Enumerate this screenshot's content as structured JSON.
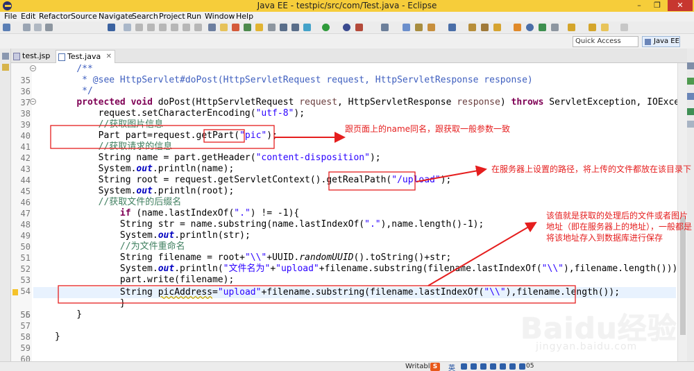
{
  "window": {
    "title": "Java EE - testpic/src/com/Test.java - Eclipse",
    "min": "–",
    "max": "❐",
    "close": "✕"
  },
  "menu": [
    "File",
    "Edit",
    "Refactor",
    "Source",
    "Navigate",
    "Search",
    "Project",
    "Run",
    "Window",
    "Help"
  ],
  "toolbar": {
    "quick_access_placeholder": "Quick Access",
    "perspective": "Java EE"
  },
  "tabs": [
    {
      "label": "test.jsp",
      "icon": "jsp-file-icon",
      "active": false
    },
    {
      "label": "Test.java",
      "icon": "java-file-icon",
      "active": true,
      "close": "✕"
    }
  ],
  "code_lines": [
    {
      "num": "35",
      "text": "    /**"
    },
    {
      "num": "36",
      "text": "     * @see HttpServlet#doPost(HttpServletRequest request, HttpServletResponse response)"
    },
    {
      "num": "37",
      "text": "     */"
    },
    {
      "num": "38",
      "text": "    protected void doPost(HttpServletRequest request, HttpServletResponse response) throws ServletException, IOException {"
    },
    {
      "num": "39",
      "text": "        request.setCharacterEncoding(\"utf-8\");"
    },
    {
      "num": "40",
      "text": "        //获取图片信息"
    },
    {
      "num": "41",
      "text": "        Part part=request.getPart(\"pic\");"
    },
    {
      "num": "42",
      "text": "        //获取请求的信息"
    },
    {
      "num": "43",
      "text": "        String name = part.getHeader(\"content-disposition\");"
    },
    {
      "num": "44",
      "text": "        System.out.println(name);"
    },
    {
      "num": "45",
      "text": "        String root = request.getServletContext().getRealPath(\"/upload\");"
    },
    {
      "num": "46",
      "text": "        System.out.println(root);"
    },
    {
      "num": "47",
      "text": "        //获取文件的后缀名"
    },
    {
      "num": "48",
      "text": "            if (name.lastIndexOf(\".\") != -1){"
    },
    {
      "num": "49",
      "text": "            String str = name.substring(name.lastIndexOf(\".\"),name.length()-1);"
    },
    {
      "num": "50",
      "text": "            System.out.println(str);"
    },
    {
      "num": "51",
      "text": "            //为文件重命名"
    },
    {
      "num": "52",
      "text": "            String filename = root+\"\\\\\"+UUID.randomUUID().toString()+str;"
    },
    {
      "num": "53",
      "text": "            System.out.println(\"文件名为\"+\"upload\"+filename.substring(filename.lastIndexOf(\"\\\\\"),filename.length()));"
    },
    {
      "num": "54",
      "text": "            part.write(filename);"
    },
    {
      "num": "55",
      "text": "            String picAddress=\"upload\"+filename.substring(filename.lastIndexOf(\"\\\\\"),filename.length());"
    },
    {
      "num": "56",
      "text": "            }"
    },
    {
      "num": "57",
      "text": "    }"
    },
    {
      "num": "58",
      "text": ""
    },
    {
      "num": "59",
      "text": "}"
    },
    {
      "num": "60",
      "text": ""
    }
  ],
  "annotations": [
    {
      "text": "跟页面上的name同名，跟获取一般参数一致"
    },
    {
      "text": "在服务器上设置的路径，将上传的文件都放在该目录下"
    },
    {
      "text": "该值就是获取的处理后的文件或者图片地址（即在服务器上的地址），一般都是将该地址存入到数据库进行保存"
    }
  ],
  "watermark": {
    "brand": "Baidu经验",
    "url": "jingyan.baidu.com"
  },
  "status": {
    "writable": "Writable",
    "ime": "S",
    "lang": "英",
    "extra": "05"
  },
  "colors": {
    "titlebar": "#f6cd3a",
    "annotation": "#e51e1e",
    "keyword": "#7f0055",
    "string": "#2a00ff",
    "comment": "#3f7f5f",
    "javadoc": "#3f5fbf"
  }
}
